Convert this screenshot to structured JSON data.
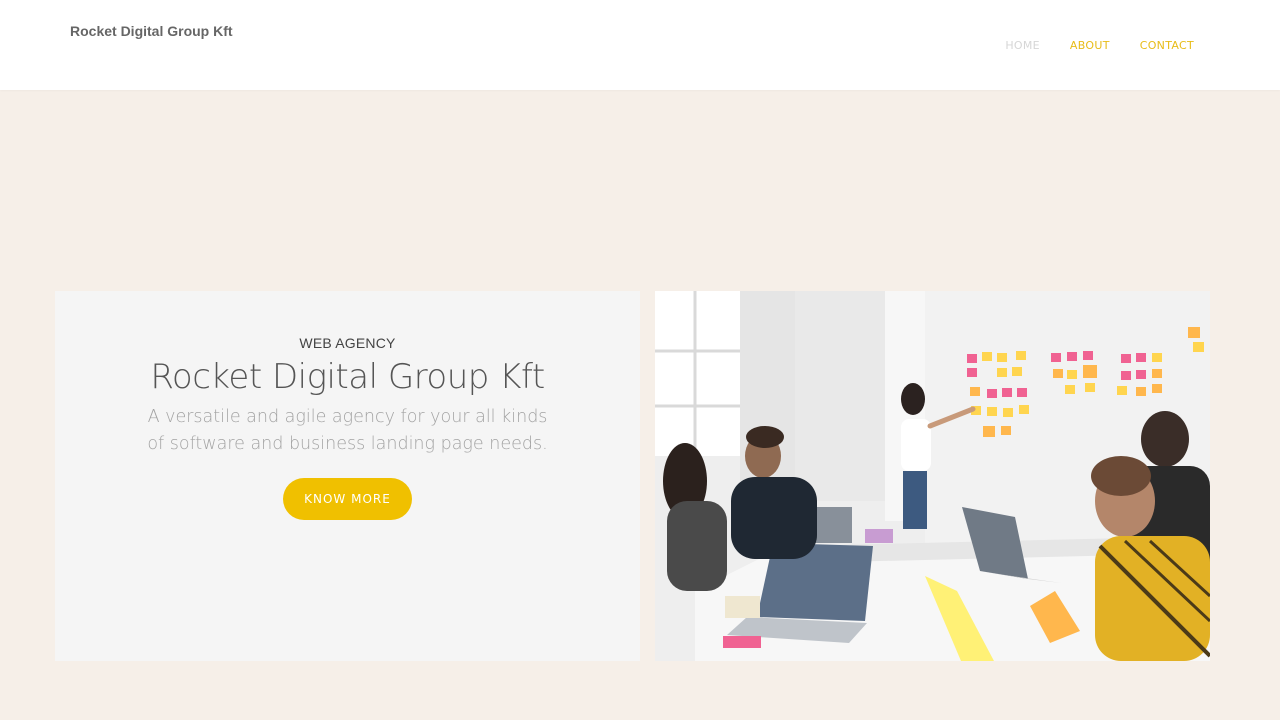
{
  "header": {
    "brand": "Rocket Digital Group Kft",
    "nav": [
      {
        "label": "HOME",
        "active": false
      },
      {
        "label": "ABOUT",
        "active": true
      },
      {
        "label": "CONTACT",
        "active": true
      }
    ]
  },
  "hero": {
    "eyebrow": "WEB AGENCY",
    "title": "Rocket Digital Group Kft",
    "subtitle_line1": "A versatile and agile agency for your all kinds",
    "subtitle_line2": "of software and business landing page needs.",
    "cta_label": "KNOW MORE"
  },
  "colors": {
    "page_bg": "#f6efe8",
    "accent": "#f0c000",
    "card_bg": "#f5f5f5"
  },
  "image": {
    "alt": "team-meeting-photo"
  }
}
